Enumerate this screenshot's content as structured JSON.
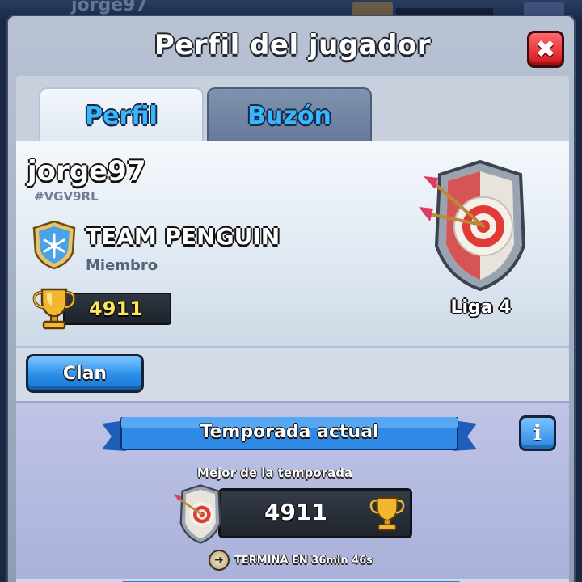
{
  "background": {
    "player_name": "jorge97"
  },
  "dialog": {
    "title": "Perfil del jugador",
    "close_symbol": "✖",
    "close_icon": "close-icon"
  },
  "tabs": [
    {
      "label": "Perfil",
      "active": true
    },
    {
      "label": "Buzón",
      "active": false
    }
  ],
  "profile": {
    "name": "jorge97",
    "tag": "#VGV9RL",
    "clan": {
      "name": "TEAM PENGUIN",
      "role": "Miembro",
      "badge_icon": "snowflake-badge-icon"
    },
    "trophies": "4911",
    "league": "Liga 4",
    "league_icon": "archery-target-league-icon"
  },
  "clan_button": {
    "label": "Clan"
  },
  "season": {
    "title": "Temporada actual",
    "info_symbol": "i",
    "best_label": "Mejor de la temporada",
    "best_trophies": "4911",
    "timer_text": "TERMINA EN 36min  46s"
  },
  "colors": {
    "accent_blue": "#36b7ff",
    "close_red": "#d3121a",
    "trophy_gold": "#ffe55a"
  }
}
